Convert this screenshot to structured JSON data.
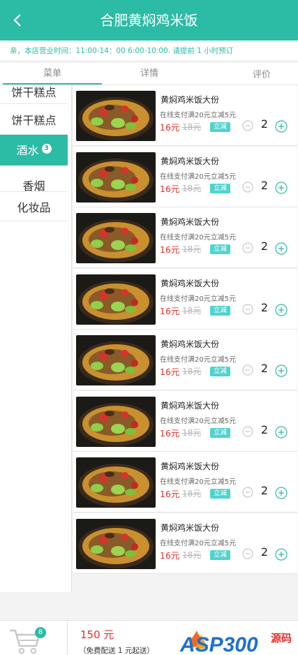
{
  "header": {
    "title": "合肥黄焖鸡米饭"
  },
  "notice": "亲，本店营业时间：11:00-14：00  6:00-10:00. 请提前 1 小时预订",
  "tabs": [
    {
      "label": "菜单",
      "active": true
    },
    {
      "label": "详情",
      "active": false
    },
    {
      "label": "评价",
      "active": false
    }
  ],
  "sidebar": {
    "items": [
      {
        "label": "饼干糕点"
      },
      {
        "label": "饼干糕点"
      },
      {
        "label": "酒水",
        "badge": "3",
        "active": true
      },
      {
        "label": "香烟"
      },
      {
        "label": "化妆品"
      }
    ]
  },
  "dishes": [
    {
      "name": "黄焖鸡米饭大份",
      "promo": "在线支付满20元立减5元",
      "price": "16元",
      "original_price": "18元",
      "tag": "立减",
      "quantity": "2"
    },
    {
      "name": "黄焖鸡米饭大份",
      "promo": "在线支付满20元立减5元",
      "price": "16元",
      "original_price": "18元",
      "tag": "立减",
      "quantity": "2"
    },
    {
      "name": "黄焖鸡米饭大份",
      "promo": "在线支付满20元立减5元",
      "price": "16元",
      "original_price": "18元",
      "tag": "立减",
      "quantity": "2"
    },
    {
      "name": "黄焖鸡米饭大份",
      "promo": "在线支付满20元立减5元",
      "price": "16元",
      "original_price": "18元",
      "tag": "立减",
      "quantity": "2"
    },
    {
      "name": "黄焖鸡米饭大份",
      "promo": "在线支付满20元立减5元",
      "price": "16元",
      "original_price": "18元",
      "tag": "立减",
      "quantity": "2"
    },
    {
      "name": "黄焖鸡米饭大份",
      "promo": "在线支付满20元立减5元",
      "price": "16元",
      "original_price": "18元",
      "tag": "立减",
      "quantity": "2"
    },
    {
      "name": "黄焖鸡米饭大份",
      "promo": "在线支付满20元立减5元",
      "price": "16元",
      "original_price": "18元",
      "tag": "立减",
      "quantity": "2"
    },
    {
      "name": "黄焖鸡米饭大份",
      "promo": "在线支付满20元立减5元",
      "price": "16元",
      "original_price": "18元",
      "tag": "立减",
      "quantity": "2"
    }
  ],
  "footer": {
    "cart_count": "8",
    "total": "150 元",
    "delivery_note": "（免费配送 1 元起送）",
    "logo_text": "ASP300",
    "logo_subtext": "源码"
  },
  "colors": {
    "accent": "#2cbba5",
    "price": "#e0302a",
    "tag": "#4fd3cf"
  }
}
